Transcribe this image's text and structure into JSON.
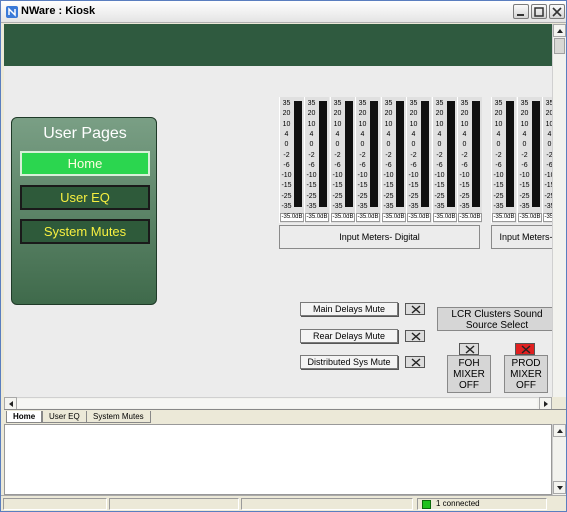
{
  "window": {
    "title": "NWare : Kiosk"
  },
  "user_pages": {
    "title": "User Pages",
    "buttons": [
      {
        "label": "Home"
      },
      {
        "label": "User EQ"
      },
      {
        "label": "System Mutes"
      }
    ]
  },
  "meters": {
    "scale": [
      "35",
      "20",
      "10",
      "4",
      "0",
      "-2",
      "-6",
      "-10",
      "-15",
      "-25",
      "-35"
    ],
    "readout": "-35.0dB",
    "count_visible": 11,
    "group_labels": [
      "Input Meters- Digital",
      "Input Meters-"
    ]
  },
  "mutes": [
    {
      "label": "Main Delays Mute"
    },
    {
      "label": "Rear Delays Mute"
    },
    {
      "label": "Distributed Sys Mute"
    }
  ],
  "lcr": {
    "label": "LCR Clusters Sound Source Select"
  },
  "mixers": [
    {
      "label": "FOH MIXER OFF",
      "color": "#dcdcdc"
    },
    {
      "label": "PROD MIXER OFF",
      "color": "#e02020"
    }
  ],
  "tabs": [
    {
      "label": "Home"
    },
    {
      "label": "User EQ"
    },
    {
      "label": "System Mutes"
    }
  ],
  "status": {
    "connection": "1 connected",
    "connection_color": "#1ec21e"
  },
  "colors": {
    "banner": "#2f5a3f",
    "home_active": "#2bd64f",
    "nav_text": "#f7f040"
  }
}
